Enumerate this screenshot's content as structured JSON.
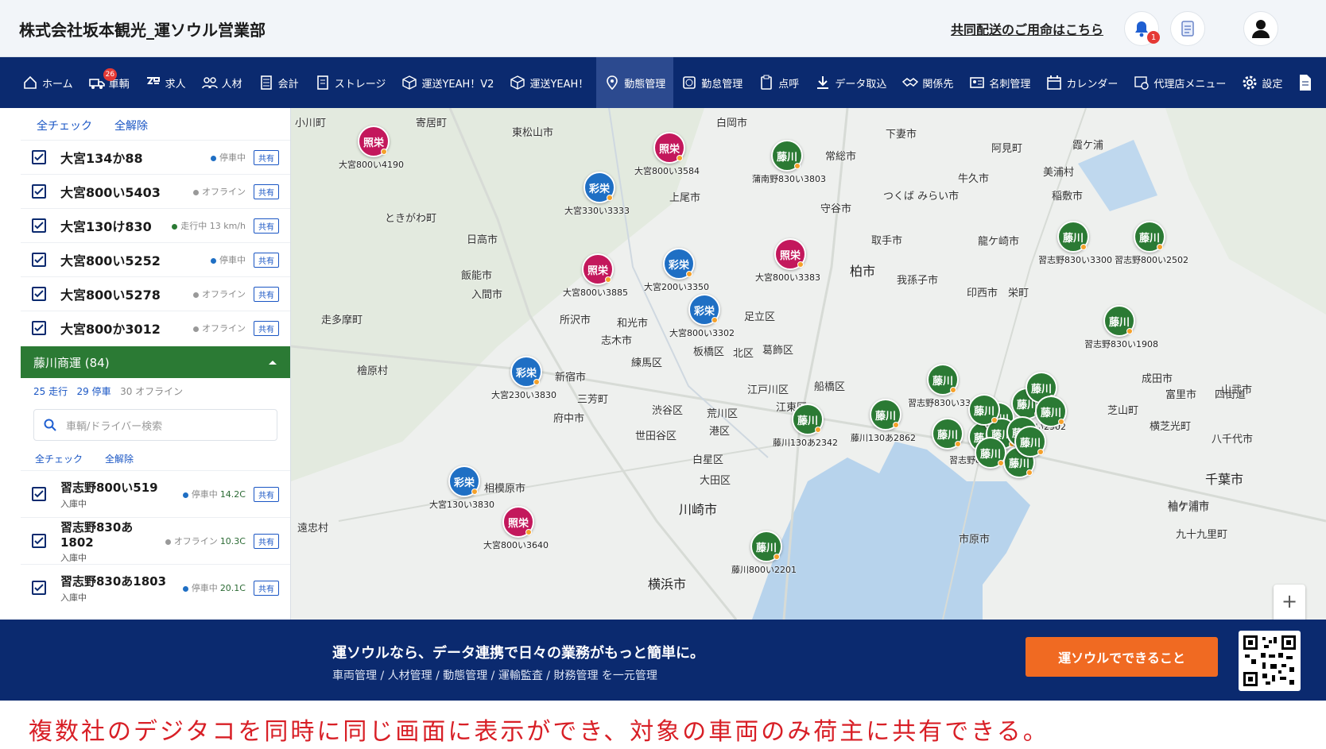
{
  "header": {
    "company_title": "株式会社坂本観光_運ソウル営業部",
    "joint_delivery_link": "共同配送のご用命はこちら",
    "notification_count": "1"
  },
  "nav": {
    "items": [
      {
        "label": "ホーム"
      },
      {
        "label": "車輌",
        "badge": "26"
      },
      {
        "label": "求人"
      },
      {
        "label": "人材"
      },
      {
        "label": "会計"
      },
      {
        "label": "ストレージ"
      },
      {
        "label": "運送YEAH！V2"
      },
      {
        "label": "運送YEAH！"
      },
      {
        "label": "動態管理",
        "active": true
      },
      {
        "label": "勤怠管理"
      },
      {
        "label": "点呼"
      },
      {
        "label": "データ取込"
      },
      {
        "label": "関係先"
      },
      {
        "label": "名刺管理"
      },
      {
        "label": "カレンダー"
      },
      {
        "label": "代理店メニュー"
      },
      {
        "label": "設定"
      }
    ]
  },
  "sidebar": {
    "check_all": "全チェック",
    "uncheck_all": "全解除",
    "shared_label": "共有",
    "vehicles_top": [
      {
        "plate": "大宮134か88",
        "status": "停車中",
        "status_color": "#1f6fc4"
      },
      {
        "plate": "大宮800い5403",
        "status": "オフライン",
        "status_color": "#999999"
      },
      {
        "plate": "大宮130け830",
        "status": "走行中 13 km/h",
        "status_color": "#2b7a34"
      },
      {
        "plate": "大宮800い5252",
        "status": "停車中",
        "status_color": "#1f6fc4"
      },
      {
        "plate": "大宮800い5278",
        "status": "オフライン",
        "status_color": "#999999"
      },
      {
        "plate": "大宮800か3012",
        "status": "オフライン",
        "status_color": "#999999"
      }
    ],
    "group": {
      "name": "藤川商運 (84)",
      "running": "25 走行",
      "stopped": "29 停車",
      "offline": "30 オフライン",
      "search_placeholder": "車輌/ドライバー検索",
      "check_all": "全チェック",
      "uncheck_all": "全解除",
      "vehicles": [
        {
          "plate": "習志野800い519",
          "sub": "入庫中",
          "status": "停車中",
          "temp": "14.2C",
          "status_color": "#1f6fc4"
        },
        {
          "plate": "習志野830あ1802",
          "sub": "入庫中",
          "status": "オフライン",
          "temp": "10.3C",
          "status_color": "#999999"
        },
        {
          "plate": "習志野830あ1803",
          "sub": "入庫中",
          "status": "停車中",
          "temp": "20.1C",
          "status_color": "#1f6fc4"
        }
      ]
    }
  },
  "map": {
    "places": [
      "小川町",
      "寄居町",
      "東松山市",
      "白岡市",
      "常総市",
      "下妻市",
      "阿見町",
      "霞ケ浦",
      "美浦村",
      "ときがわ町",
      "上尾市",
      "守谷市",
      "つくば みらい市",
      "牛久市",
      "稲敷市",
      "日高市",
      "飯能市",
      "入間市",
      "取手市",
      "龍ケ崎市",
      "柏市",
      "我孫子市",
      "印西市",
      "栄町",
      "所沢市",
      "足立区",
      "走多摩町",
      "和光市",
      "志木市",
      "板橋区",
      "北区",
      "葛飾区",
      "練馬区",
      "成田市",
      "富里市",
      "檜原村",
      "新宿市",
      "三芳町",
      "荒川区",
      "江戸川区",
      "船橋区",
      "八千代市",
      "芝山町",
      "府中市",
      "渋谷区",
      "江東区",
      "港区",
      "世田谷区",
      "白星区",
      "大田区",
      "相模原市",
      "川崎市",
      "遠忠村",
      "市原市",
      "袖ケ浦市",
      "横浜市",
      "袖ケ浦市",
      "九十九里町",
      "千葉市",
      "横芝光町",
      "四街道",
      "山武市"
    ],
    "pins_ts": [
      {
        "label": "大宮800い4190"
      },
      {
        "label": "大宮800い3584"
      },
      {
        "label": "大宮800い3885"
      },
      {
        "label": "大宮800い3383"
      },
      {
        "label": "大宮800い3640"
      }
    ],
    "pins_sk": [
      {
        "label": "大宮330い3333"
      },
      {
        "label": "大宮200い3350"
      },
      {
        "label": "大宮800い3302"
      },
      {
        "label": "大宮230い3830"
      },
      {
        "label": "大宮130い3830"
      }
    ],
    "pins_fk": [
      {
        "label": "蒲南野830い3803"
      },
      {
        "label": "習志野830い3300"
      },
      {
        "label": "習志野800い2502"
      },
      {
        "label": "習志野830い1908"
      },
      {
        "label": "習志野830い3303"
      },
      {
        "label": "藤川130あ2342"
      },
      {
        "label": "藤川130あ2862"
      },
      {
        "label": "習志野830い2908"
      },
      {
        "label": "藤川800い2201"
      },
      {
        "label": "習志野830い2902"
      }
    ],
    "pin_text_ts": "照栄",
    "pin_text_sk": "彩栄",
    "pin_text_fk": "藤川"
  },
  "banner": {
    "headline": "運ソウルなら、データ連携で日々の業務がもっと簡単に。",
    "subline": "車両管理 / 人材管理 / 動態管理 / 運輸監査 / 財務管理 を一元管理",
    "cta": "運ソウルでできること"
  },
  "caption": "複数社のデジタコを同時に同じ画面に表示ができ、対象の車両のみ荷主に共有できる。",
  "colors": {
    "nav_bg": "#0b2a6f",
    "accent_orange": "#f06a22",
    "caption_red": "#d81f26",
    "group_green": "#2b7a34",
    "pin_shoei": "#c3185c",
    "pin_saiei": "#1f6fc4",
    "pin_fujikawa": "#2b7a34"
  }
}
